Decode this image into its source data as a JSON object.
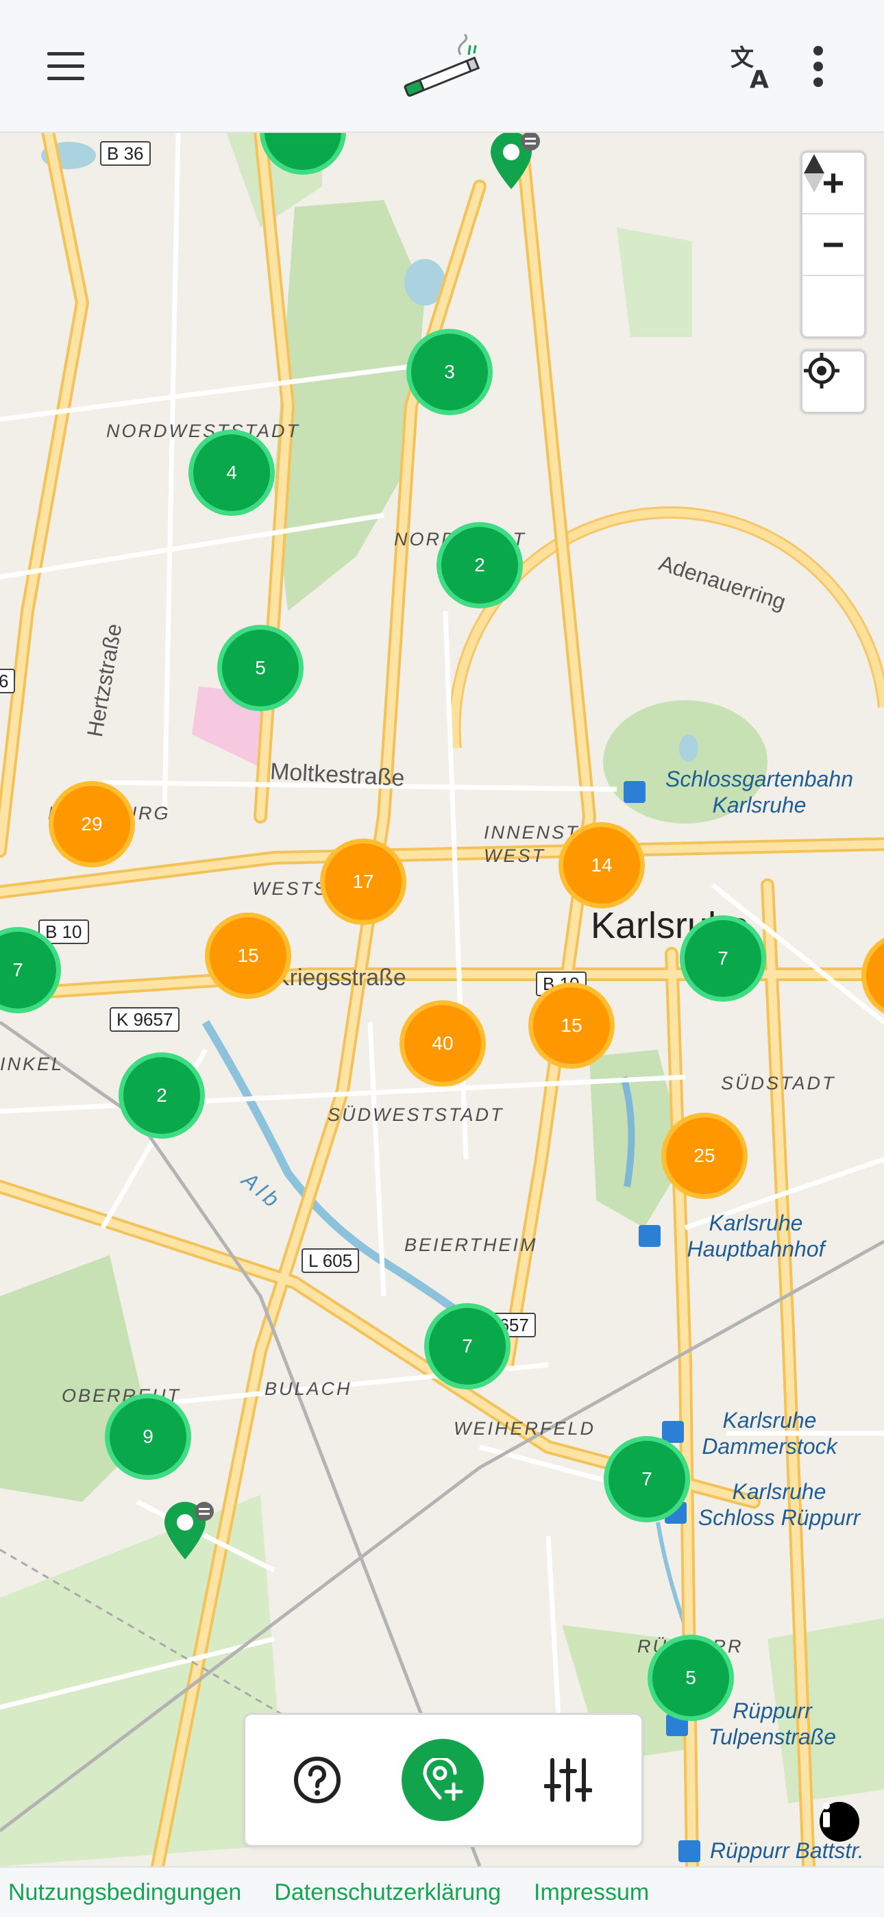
{
  "header": {
    "menu_icon": "hamburger-menu-icon",
    "logo_icon": "cigarette-butt-logo",
    "translate_icon": "translate-icon",
    "more_icon": "more-vertical-icon"
  },
  "map": {
    "zoom_in": "+",
    "zoom_out": "−",
    "city_label": "Karlsruhe",
    "district_labels": {
      "nordweststadt": "NORDWESTSTADT",
      "nordstadt": "NORDSTADT",
      "muhlburg": "MÜHLBURG",
      "weststadt": "WESTSTADT",
      "innenstadt": "INNENSTADT WEST",
      "sudweststadt": "SÜDWESTSTADT",
      "sudstadt": "SÜDSTADT",
      "beiertheim": "BEIERTHEIM",
      "bulach": "BULACH",
      "oberreut": "OBERREUT",
      "weiherfeld": "WEIHERFELD",
      "ruppurr": "RÜPPURR",
      "inkel": "INKEL"
    },
    "street_labels": {
      "hertzstrasse": "Hertzstraße",
      "moltkestrasse": "Moltkestraße",
      "kriegsstrasse": "Kriegsstraße",
      "adenauerring": "Adenauerring",
      "alb": "Alb"
    },
    "road_shields": {
      "b36": "B 36",
      "b10_west": "B 10",
      "b10_center": "B 10",
      "k9657": "K 9657",
      "l605": "L 605",
      "k9657_partial": "9657",
      "six": "6"
    },
    "stations": {
      "schlossgarten": "Schlossgartenbahn Karlsruhe",
      "hauptbahnhof": "Karlsruhe Hauptbahnhof",
      "dammerstock": "Karlsruhe Dammerstock",
      "schloss_ruppurr": "Karlsruhe Schloss Rüppurr",
      "tulpenstrasse": "Rüppurr Tulpenstraße",
      "battstrasse": "Rüppurr Battstr."
    },
    "clusters": [
      {
        "count": "3",
        "color": "green"
      },
      {
        "count": "4",
        "color": "green"
      },
      {
        "count": "2",
        "color": "green"
      },
      {
        "count": "5",
        "color": "green"
      },
      {
        "count": "29",
        "color": "orange"
      },
      {
        "count": "17",
        "color": "orange"
      },
      {
        "count": "14",
        "color": "orange"
      },
      {
        "count": "7",
        "color": "green"
      },
      {
        "count": "7",
        "color": "green"
      },
      {
        "count": "15",
        "color": "orange"
      },
      {
        "count": "40",
        "color": "orange"
      },
      {
        "count": "15",
        "color": "orange"
      },
      {
        "count": "2",
        "color": "green"
      },
      {
        "count": "25",
        "color": "orange"
      },
      {
        "count": "7",
        "color": "green"
      },
      {
        "count": "9",
        "color": "green"
      },
      {
        "count": "7",
        "color": "green"
      },
      {
        "count": "5",
        "color": "green"
      }
    ],
    "colors": {
      "green_cluster": "#09a84a",
      "orange_cluster": "#ff9800",
      "accent": "#18a352"
    }
  },
  "bottom_panel": {
    "help_icon": "help-circle-icon",
    "add_location_icon": "add-location-pin-icon",
    "filter_icon": "sliders-filter-icon"
  },
  "footer": {
    "terms": "Nutzungsbedingungen",
    "privacy": "Datenschutzerklärung",
    "imprint": "Impressum"
  }
}
